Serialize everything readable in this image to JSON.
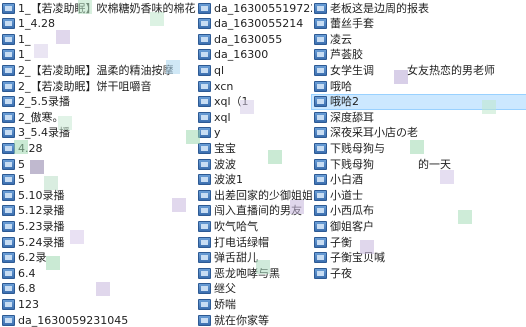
{
  "columns": [
    {
      "items": [
        {
          "label": "1_【若凌助眠】吹棉糖奶香味的棉花糖"
        },
        {
          "label": "1_4.28"
        },
        {
          "label": "1_"
        },
        {
          "label": "1_"
        },
        {
          "label": "2_【若凌助眠】温柔的精油按摩"
        },
        {
          "label": "2_【若凌助眠】饼干咀嚼音"
        },
        {
          "label": "2_5.5录播"
        },
        {
          "label": "2_傲寒。"
        },
        {
          "label": "3_5.4录播"
        },
        {
          "label": "4.28"
        },
        {
          "label": "5"
        },
        {
          "label": "5"
        },
        {
          "label": "5.10录播"
        },
        {
          "label": "5.12录播"
        },
        {
          "label": "5.23录播"
        },
        {
          "label": "5.24录播"
        },
        {
          "label": "6.2录"
        },
        {
          "label": "6.4"
        },
        {
          "label": "6.8"
        },
        {
          "label": "123"
        },
        {
          "label": "da_1630059231045"
        }
      ]
    },
    {
      "items": [
        {
          "label": "da_1630055197225"
        },
        {
          "label": "da_1630055214"
        },
        {
          "label": "da_1630055"
        },
        {
          "label": "da_16300"
        },
        {
          "label": "ql"
        },
        {
          "label": "xcn"
        },
        {
          "label": "xql（1"
        },
        {
          "label": "xql"
        },
        {
          "label": "y"
        },
        {
          "label": "宝宝"
        },
        {
          "label": "波波"
        },
        {
          "label": "波波1"
        },
        {
          "label": "出差回家的少御姐姐"
        },
        {
          "label": "闯入直播间的男友"
        },
        {
          "label": "吹气哈气"
        },
        {
          "label": "打电话绿帽"
        },
        {
          "label": "弹舌甜儿"
        },
        {
          "label": "恶龙咆哮与黑"
        },
        {
          "label": "继父"
        },
        {
          "label": "娇喘"
        },
        {
          "label": "就在你家等"
        }
      ]
    },
    {
      "items": [
        {
          "label": "老板这是边周的报表"
        },
        {
          "label": "蕾丝手套"
        },
        {
          "label": "凌云"
        },
        {
          "label": "芦荟胶"
        },
        {
          "label": "女学生调　　　女友热恋的男老师"
        },
        {
          "label": "哦哈"
        },
        {
          "label": "哦哈2"
        },
        {
          "label": "深度舔耳"
        },
        {
          "label": "深夜采耳小店の老"
        },
        {
          "label": "下贱母狗与"
        },
        {
          "label": "下贱母狗　　　　的一天"
        },
        {
          "label": "小白酒"
        },
        {
          "label": "小道士"
        },
        {
          "label": "小西瓜布"
        },
        {
          "label": "御姐客户"
        },
        {
          "label": "子衡"
        },
        {
          "label": "子衡宝贝喊"
        },
        {
          "label": "子夜"
        }
      ]
    }
  ],
  "selected_item": "哦哈2",
  "colors": {
    "file_icon": "#3c6fb0",
    "selection_bg": "#cce8ff",
    "mosaic_green": "#9ed8b0",
    "mosaic_purple": "#c7b6dd"
  },
  "icon_name": "audio-file-icon"
}
